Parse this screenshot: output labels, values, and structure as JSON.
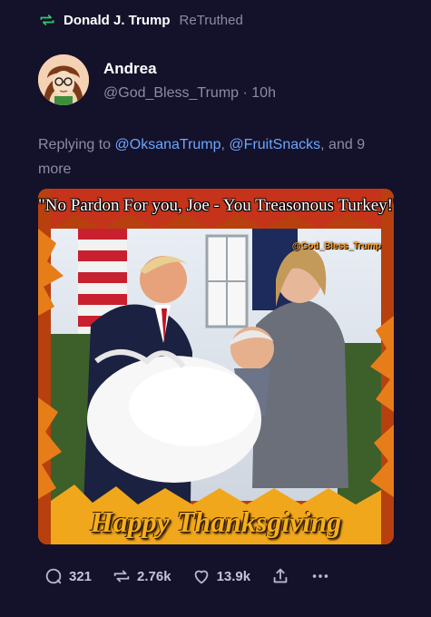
{
  "retruth": {
    "name": "Donald J. Trump",
    "suffix": "ReTruthed",
    "icon": "retruth-icon",
    "accent": "#2ecc71"
  },
  "author": {
    "name": "Andrea",
    "handle": "@God_Bless_Trump",
    "separator": "·",
    "time": "10h",
    "avatar_icon": "avatar"
  },
  "reply": {
    "prefix": "Replying to",
    "mentions": [
      "@OksanaTrump",
      "@FruitSnacks"
    ],
    "comma": ",",
    "suffix": "and 9 more"
  },
  "media": {
    "top_caption": "\"No Pardon For you, Joe - You Treasonous Turkey!\"",
    "watermark": "@God_Bless_Trump",
    "bottom_caption": "Happy Thanksgiving"
  },
  "actions": {
    "replies": "321",
    "retruths": "2.76k",
    "likes": "13.9k",
    "share_icon": "share-icon",
    "more_icon": "more-icon"
  },
  "colors": {
    "background": "#14112a",
    "muted": "#8e8aa6",
    "link": "#6aa6ff"
  }
}
